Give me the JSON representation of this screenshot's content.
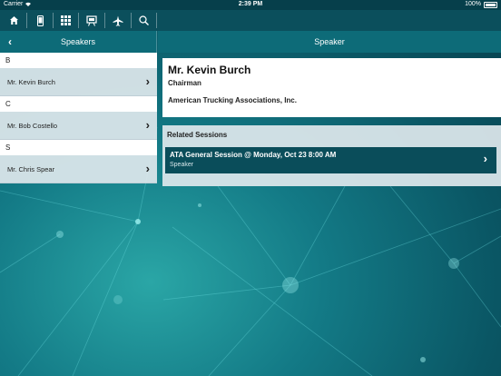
{
  "status_bar": {
    "carrier": "Carrier",
    "time": "2:39 PM",
    "battery": "100%"
  },
  "toolbar": {
    "icons": [
      "home-icon",
      "phone-icon",
      "grid-icon",
      "presentation-icon",
      "airplane-icon",
      "search-icon"
    ]
  },
  "left_nav": {
    "title": "Speakers"
  },
  "right_nav": {
    "title": "Speaker"
  },
  "speaker_list": [
    {
      "header": "B",
      "items": [
        {
          "name": "Mr. Kevin Burch"
        }
      ]
    },
    {
      "header": "C",
      "items": [
        {
          "name": "Mr. Bob Costello"
        }
      ]
    },
    {
      "header": "S",
      "items": [
        {
          "name": "Mr. Chris Spear"
        }
      ]
    }
  ],
  "detail": {
    "name": "Mr. Kevin Burch",
    "title": "Chairman",
    "organization": "American Trucking Associations, Inc."
  },
  "related_sessions": {
    "heading": "Related Sessions",
    "sessions": [
      {
        "title": "ATA General Session @ Monday, Oct 23 8:00 AM",
        "role": "Speaker"
      }
    ]
  },
  "colors": {
    "toolbar_bg": "#0b4f5c",
    "navbar_bg": "#0d6b78",
    "session_row_bg": "#0a4d5a"
  }
}
